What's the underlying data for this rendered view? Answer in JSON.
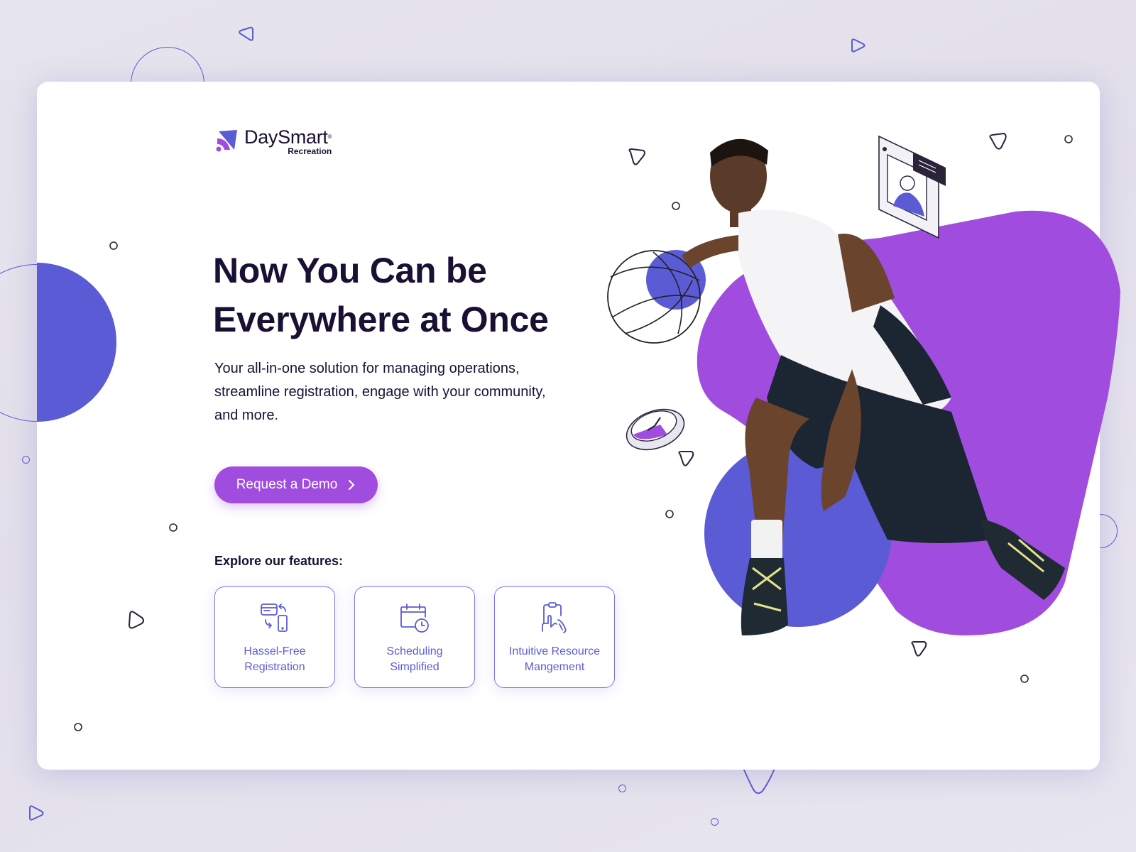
{
  "brand": {
    "name": "DaySmart",
    "trademark": "®",
    "product": "Recreation"
  },
  "hero": {
    "headline_line1": "Now You Can be",
    "headline_line2": "Everywhere at Once",
    "subtext": "Your all-in-one solution for managing operations, streamline registration, engage with your community, and more.",
    "cta_label": "Request a Demo",
    "cta_icon": "chevron-right-icon"
  },
  "features": {
    "title": "Explore our features:",
    "items": [
      {
        "line1": "Hassel-Free",
        "line2": "Registration",
        "icon": "card-phone-sync-icon"
      },
      {
        "line1": "Scheduling",
        "line2": "Simplified",
        "icon": "calendar-clock-icon"
      },
      {
        "line1": "Intuitive Resource",
        "line2": "Mangement",
        "icon": "clipboard-hand-icon"
      }
    ]
  },
  "colors": {
    "primary_purple": "#A04DDF",
    "indigo": "#5B5BD6",
    "text_dark": "#1A1033",
    "background": "#E4E2EC"
  }
}
